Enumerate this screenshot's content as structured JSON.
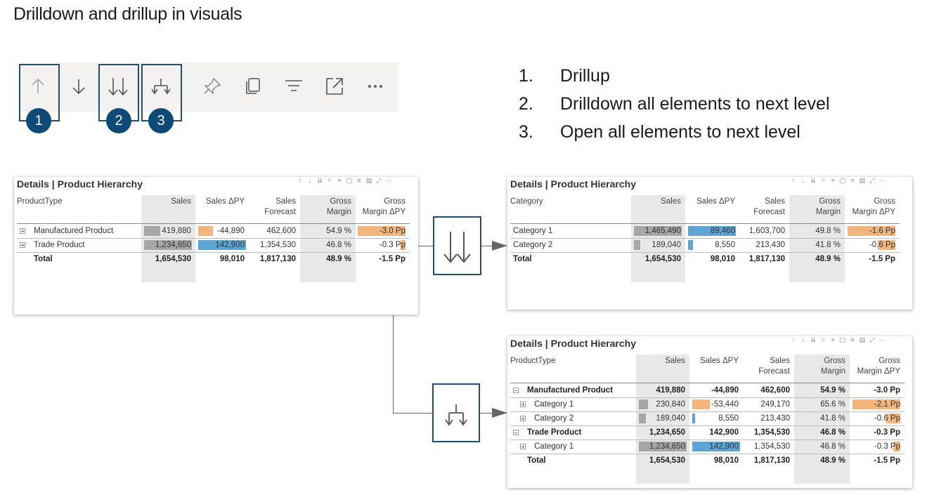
{
  "page": {
    "title": "Drilldown and drillup in visuals"
  },
  "toolbar": {
    "icons": [
      "arrow-up-icon",
      "arrow-down-icon",
      "double-arrow-down-icon",
      "expand-fork-icon",
      "pin-icon",
      "copy-icon",
      "filter-icon",
      "focus-mode-icon",
      "more-options-icon"
    ],
    "badges": [
      "1",
      "2",
      "3"
    ]
  },
  "legend": [
    {
      "num": "1.",
      "text": "Drillup"
    },
    {
      "num": "2.",
      "text": "Drilldown all elements to next level"
    },
    {
      "num": "3.",
      "text": "Open all elements to next level"
    }
  ],
  "colors": {
    "accent": "#1f4e79",
    "badge": "#0e4a78",
    "gray_bar": "#a6a6a6",
    "blue_bar": "#5aa5d6",
    "orange_bar": "#f4b57a",
    "header_shade": "#e8e8e8"
  },
  "visual_a": {
    "title": "Details | Product Hierarchy",
    "columns": [
      "ProductType",
      "Sales",
      "Sales ΔPY",
      "Sales Forecast",
      "Gross Margin",
      "Gross Margin ΔPY"
    ],
    "rows": [
      {
        "label": "Manufactured Product",
        "sales": "419,880",
        "sales_dpy": "-44,890",
        "forecast": "462,600",
        "gm": "54.9 %",
        "gm_dpy": "-3.0 Pp",
        "sales_frac": 0.34,
        "dpy_frac": -0.31,
        "gm_frac": -1.0
      },
      {
        "label": "Trade Product",
        "sales": "1,234,650",
        "sales_dpy": "142,900",
        "forecast": "1,354,530",
        "gm": "46.8 %",
        "gm_dpy": "-0.3 Pp",
        "sales_frac": 1.0,
        "dpy_frac": 1.0,
        "gm_frac": -0.1
      }
    ],
    "total": {
      "label": "Total",
      "sales": "1,654,530",
      "sales_dpy": "98,010",
      "forecast": "1,817,130",
      "gm": "48.9 %",
      "gm_dpy": "-1.5 Pp"
    }
  },
  "visual_b": {
    "title": "Details | Product Hierarchy",
    "columns": [
      "Category",
      "Sales",
      "Sales ΔPY",
      "Sales Forecast",
      "Gross Margin",
      "Gross Margin ΔPY"
    ],
    "rows": [
      {
        "label": "Category 1",
        "sales": "1,465,490",
        "sales_dpy": "89,460",
        "forecast": "1,603,700",
        "gm": "49.8 %",
        "gm_dpy": "-1.6 Pp",
        "sales_frac": 1.0,
        "dpy_frac": 1.0,
        "gm_frac": -1.0
      },
      {
        "label": "Category 2",
        "sales": "189,040",
        "sales_dpy": "8,550",
        "forecast": "213,430",
        "gm": "41.8 %",
        "gm_dpy": "-0.6 Pp",
        "sales_frac": 0.13,
        "dpy_frac": 0.1,
        "gm_frac": -0.37
      }
    ],
    "total": {
      "label": "Total",
      "sales": "1,654,530",
      "sales_dpy": "98,010",
      "forecast": "1,817,130",
      "gm": "48.9 %",
      "gm_dpy": "-1.5 Pp"
    }
  },
  "visual_c": {
    "title": "Details | Product Hierarchy",
    "columns": [
      "ProductType",
      "Sales",
      "Sales ΔPY",
      "Sales Forecast",
      "Gross Margin",
      "Gross Margin ΔPY"
    ],
    "rows": [
      {
        "label": "Manufactured Product",
        "level": 0,
        "bold": true,
        "sales": "419,880",
        "sales_dpy": "-44,890",
        "forecast": "462,600",
        "gm": "54.9 %",
        "gm_dpy": "-3.0 Pp"
      },
      {
        "label": "Category 1",
        "level": 1,
        "bold": false,
        "sales": "230,840",
        "sales_dpy": "-53,440",
        "forecast": "249,170",
        "gm": "65.6 %",
        "gm_dpy": "-2.1 Pp",
        "sales_frac": 0.19,
        "dpy_frac": -0.37,
        "gm_frac": -1.0
      },
      {
        "label": "Category 2",
        "level": 1,
        "bold": false,
        "sales": "189,040",
        "sales_dpy": "8,550",
        "forecast": "213,430",
        "gm": "41.8 %",
        "gm_dpy": "-0.6 Pp",
        "sales_frac": 0.15,
        "dpy_frac": 0.06,
        "gm_frac": -0.29
      },
      {
        "label": "Trade Product",
        "level": 0,
        "bold": true,
        "sales": "1,234,650",
        "sales_dpy": "142,900",
        "forecast": "1,354,530",
        "gm": "46.8 %",
        "gm_dpy": "-0.3 Pp"
      },
      {
        "label": "Category 1",
        "level": 1,
        "bold": false,
        "sales": "1,234,650",
        "sales_dpy": "142,900",
        "forecast": "1,354,530",
        "gm": "46.8 %",
        "gm_dpy": "-0.3 Pp",
        "sales_frac": 1.0,
        "dpy_frac": 1.0,
        "gm_frac": -0.14
      }
    ],
    "total": {
      "label": "Total",
      "sales": "1,654,530",
      "sales_dpy": "98,010",
      "forecast": "1,817,130",
      "gm": "48.9 %",
      "gm_dpy": "-1.5 Pp"
    }
  }
}
